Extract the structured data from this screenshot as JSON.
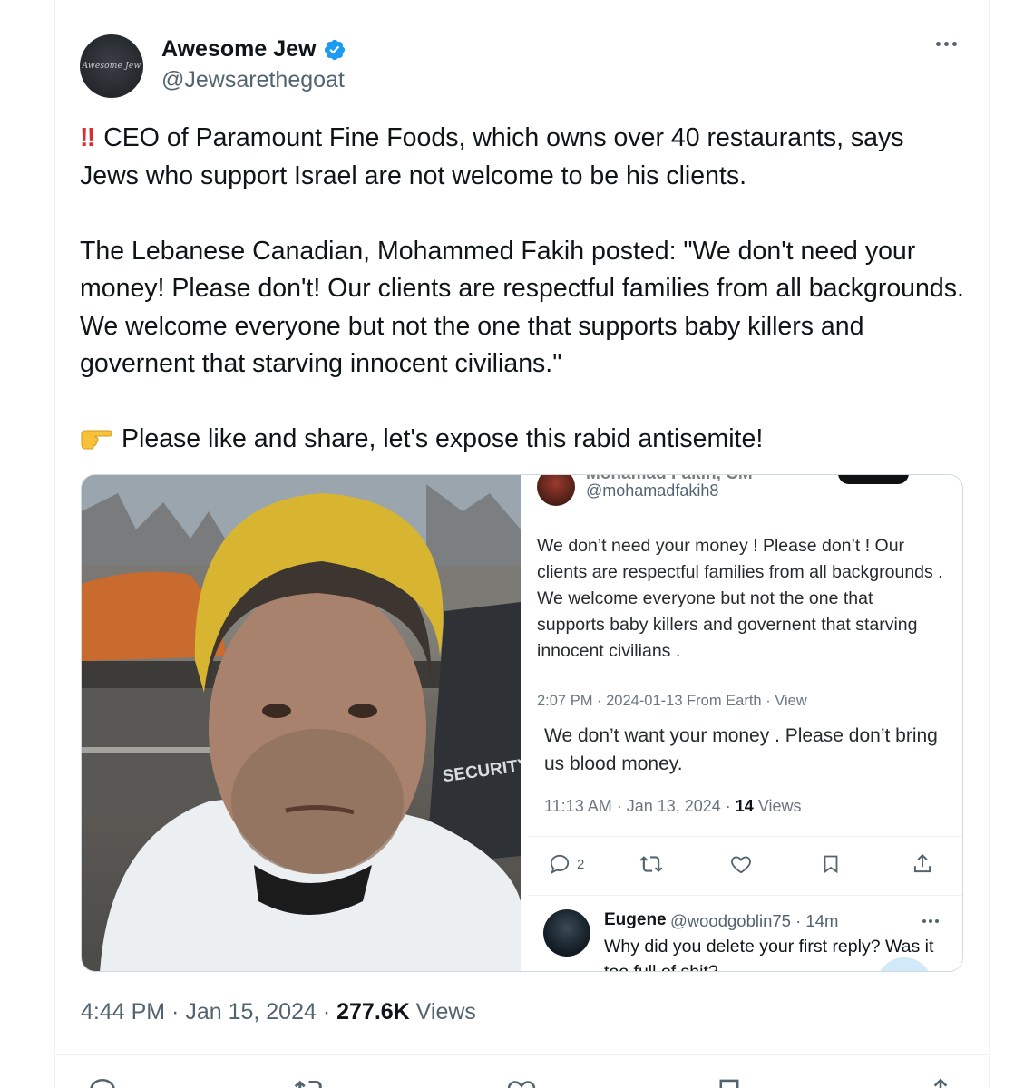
{
  "author": {
    "display_name": "Awesome Jew",
    "handle": "@Jewsarethegoat",
    "avatar_text": "Awesome Jew",
    "verified": true
  },
  "tweet": {
    "bang_emoji": "‼",
    "line1": "CEO of Paramount Fine Foods, which owns over 40 restaurants, says Jews who support Israel are not welcome to be his clients.",
    "line2": "The Lebanese Canadian, Mohammed Fakih posted: \"We don't need your money! Please don't! Our clients are respectful families from all backgrounds. We welcome everyone but not the one that supports baby killers and governent that starving innocent civilians.\"",
    "line3": "Please like and share, let's expose this rabid antisemite!"
  },
  "media": {
    "video_badge_text": "SECURITY",
    "screenshot": {
      "name_cut": "Mohamad Fakih, CM",
      "handle": "@mohamadfakih8",
      "post_text": "We don’t need your money ! Please don’t ! Our clients are respectful families from all backgrounds . We welcome everyone but not the one that supports baby killers and governent that starving innocent civilians .",
      "post_meta": "2:07 PM · 2024-01-13 From Earth · View",
      "second_text": "We don’t want your money . Please don’t bring us blood money.",
      "second_meta_prefix": "11:13 AM · Jan 13, 2024 · ",
      "second_views_count": "14",
      "second_views_label": " Views",
      "reply_count": "2",
      "reply": {
        "name": "Eugene",
        "handle": "@woodgoblin75 · 14m",
        "text": "Why did you delete your first reply?  Was it too full of shit?"
      }
    }
  },
  "meta": {
    "time_date": "4:44 PM · Jan 15, 2024 · ",
    "views_count": "277.6K",
    "views_label": " Views"
  },
  "actions": {
    "replies": "",
    "reposts": "",
    "likes": "",
    "bookmarks": ""
  },
  "colors": {
    "accent": "#1d9bf0",
    "text": "#0f1419",
    "secondary": "#536471"
  }
}
